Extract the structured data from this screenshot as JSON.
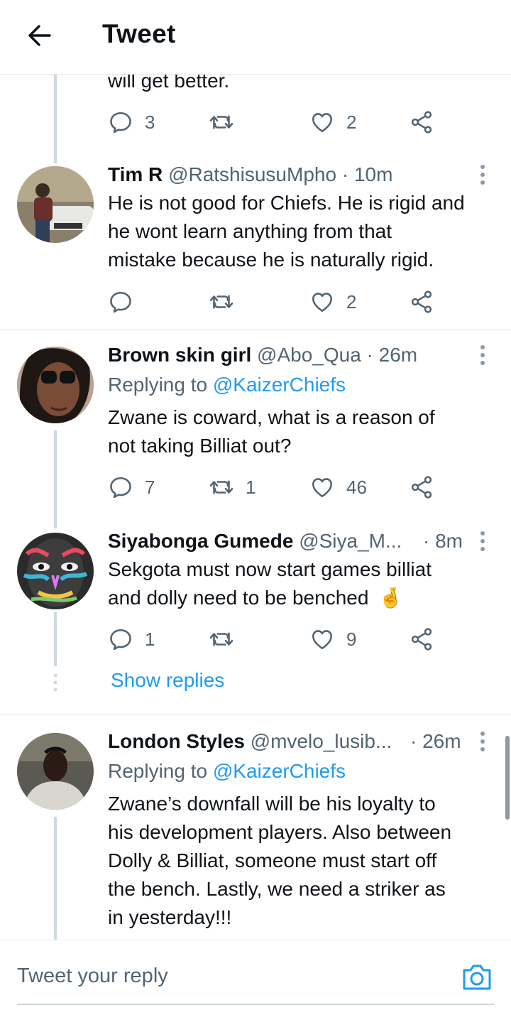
{
  "header": {
    "title": "Tweet"
  },
  "prev_tweet": {
    "text_tail": "will get better.",
    "reply_count": "3",
    "retweet_count": "",
    "like_count": "2"
  },
  "tweets": [
    {
      "name": "Tim R",
      "handle": "@RatshisusuMpho",
      "time": "· 10m",
      "lines": [
        "He is not good for Chiefs. He is rigid and",
        "he wont learn anything from that",
        "mistake because he is naturally rigid."
      ],
      "reply_count": "",
      "retweet_count": "",
      "like_count": "2"
    },
    {
      "name": "Brown skin girl",
      "handle": "@Abo_Qua",
      "time": "· 26m",
      "replying_prefix": "Replying to",
      "replying_to": "@KaizerChiefs",
      "lines": [
        "Zwane is coward, what is a reason of",
        "not taking Billiat out?"
      ],
      "reply_count": "7",
      "retweet_count": "1",
      "like_count": "46"
    },
    {
      "name": "Siyabonga Gumede",
      "handle": "@Siya_M...",
      "time": "· 8m",
      "lines": [
        "Sekgota must now start games billiat",
        "and dolly need to be benched"
      ],
      "emoji": "🤞",
      "reply_count": "1",
      "retweet_count": "",
      "like_count": "9"
    },
    {
      "name": "London Styles",
      "handle": "@mvelo_lusib...",
      "time": "· 26m",
      "replying_prefix": "Replying to",
      "replying_to": "@KaizerChiefs",
      "lines": [
        "Zwane’s downfall will be his loyalty to",
        "his development players. Also between",
        "Dolly & Billiat, someone must start off",
        "the bench. Lastly, we need a striker as",
        "in yesterday!!!"
      ]
    }
  ],
  "show_replies": "Show replies",
  "reply_box": {
    "placeholder": "Tweet your reply"
  },
  "colors": {
    "accent": "#1d9bf0",
    "secondary_text": "#536471",
    "divider": "#e1e8ed",
    "thread_line": "#cfd9de"
  }
}
